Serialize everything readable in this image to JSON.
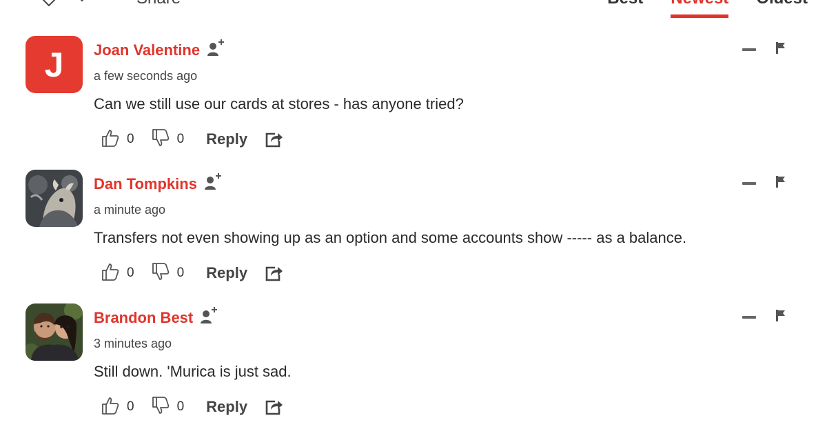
{
  "toolbar": {
    "share_label": "Share",
    "sort_tabs": [
      {
        "label": "Best",
        "active": false
      },
      {
        "label": "Newest",
        "active": true
      },
      {
        "label": "Oldest",
        "active": false
      }
    ]
  },
  "colors": {
    "accent": "#e0342b",
    "avatar_letter_bg": "#e53a2f"
  },
  "comments": [
    {
      "author": "Joan Valentine",
      "avatar_letter": "J",
      "timestamp": "a few seconds ago",
      "text": "Can we still use our cards at stores - has anyone tried?",
      "upvotes": "0",
      "downvotes": "0",
      "reply_label": "Reply"
    },
    {
      "author": "Dan Tompkins",
      "timestamp": "a minute ago",
      "text": "Transfers not even showing up as an option and some accounts show ----- as a balance.",
      "upvotes": "0",
      "downvotes": "0",
      "reply_label": "Reply"
    },
    {
      "author": "Brandon Best",
      "timestamp": "3 minutes ago",
      "text": "Still down. 'Murica is just sad.",
      "upvotes": "0",
      "downvotes": "0",
      "reply_label": "Reply"
    }
  ],
  "icons": [
    "heart-icon",
    "chevron-down-icon",
    "follow-user-icon",
    "thumbs-up-icon",
    "thumbs-down-icon",
    "share-icon",
    "collapse-icon",
    "flag-icon"
  ]
}
